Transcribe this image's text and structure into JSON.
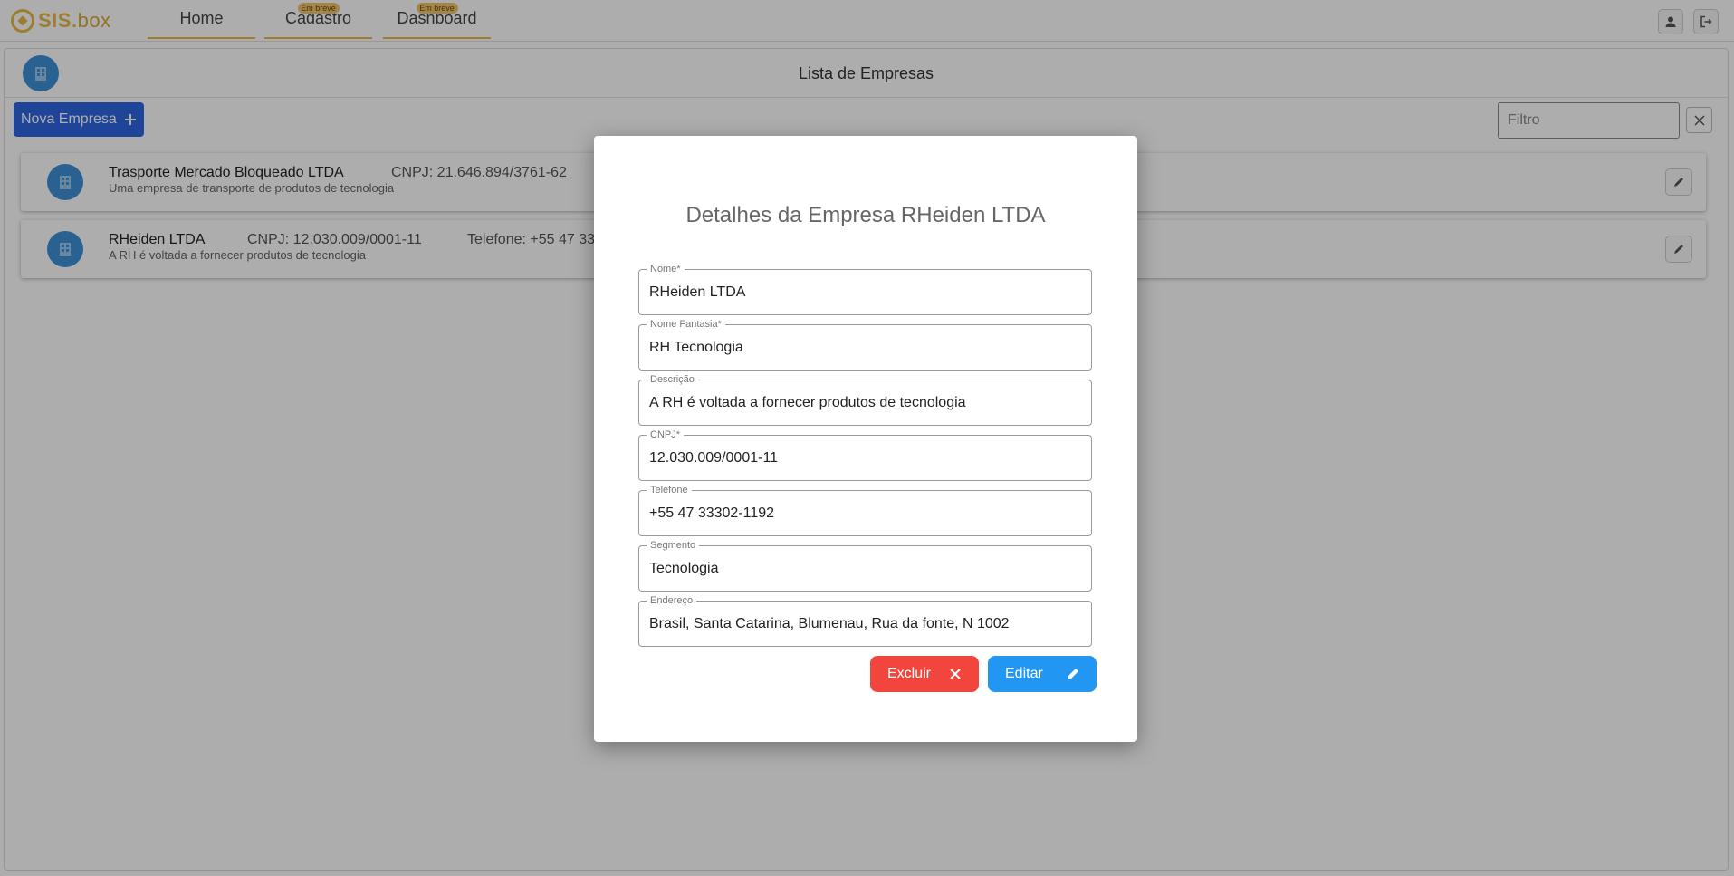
{
  "app": {
    "logo_text": "SIS.",
    "logo_suffix": "box"
  },
  "nav": {
    "items": [
      {
        "label": "Home",
        "badge": ""
      },
      {
        "label": "Cadastro",
        "badge": "Em breve"
      },
      {
        "label": "Dashboard",
        "badge": "Em breve"
      }
    ]
  },
  "header_icons": [
    "user-icon",
    "logout-icon"
  ],
  "page": {
    "title": "Lista de Empresas",
    "new_button_label": "Nova Empresa",
    "filter_placeholder": "Filtro"
  },
  "companies": [
    {
      "name": "Trasporte Mercado Bloqueado  LTDA",
      "cnpj": "CNPJ: 21.646.894/3761-62",
      "phone": "",
      "description": "Uma empresa de transporte de produtos de tecnologia"
    },
    {
      "name": "RHeiden LTDA",
      "cnpj": "CNPJ: 12.030.009/0001-11",
      "phone": "Telefone: +55 47 33",
      "description": "A RH é voltada a fornecer produtos de tecnologia"
    }
  ],
  "modal": {
    "title": "Detalhes da Empresa RHeiden LTDA",
    "fields": [
      {
        "label": "Nome*",
        "value": "RHeiden LTDA"
      },
      {
        "label": "Nome Fantasia*",
        "value": "RH Tecnologia"
      },
      {
        "label": "Descrição",
        "value": "A RH é voltada a fornecer produtos de tecnologia"
      },
      {
        "label": "CNPJ*",
        "value": "12.030.009/0001-11"
      },
      {
        "label": "Telefone",
        "value": "+55 47 33302-1192"
      },
      {
        "label": "Segmento",
        "value": "Tecnologia"
      },
      {
        "label": "Endereço",
        "value": "Brasil, Santa Catarina, Blumenau, Rua da fonte, N 1002"
      }
    ],
    "delete_label": "Excluir",
    "edit_label": "Editar"
  },
  "colors": {
    "brand": "#e9b949",
    "primary": "#2e66e0",
    "danger": "#f2453d",
    "info": "#2196f3",
    "avatar": "#3d8fd6"
  }
}
